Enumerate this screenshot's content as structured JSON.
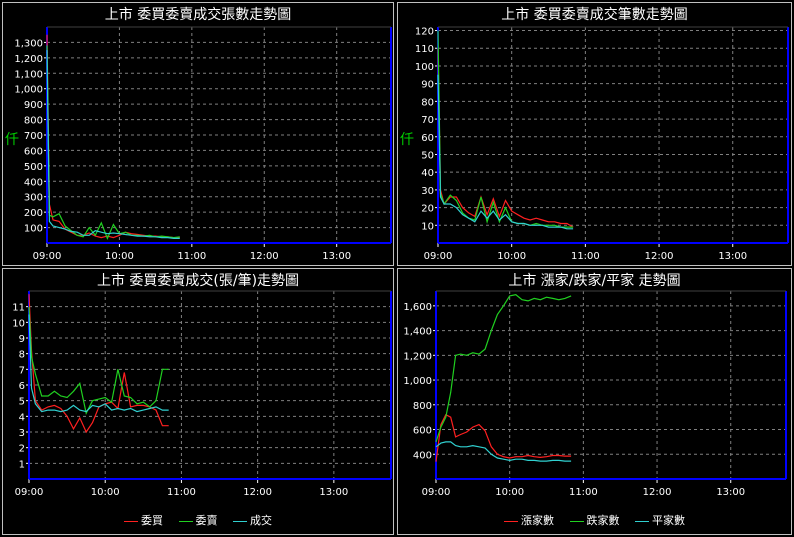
{
  "colors": {
    "red": "#ff2020",
    "green": "#20d020",
    "cyan": "#30d0d0",
    "axis": "#0000ff",
    "grid": "#808080",
    "text": "#ffffff"
  },
  "panels": [
    {
      "title": "上市  委買委賣成交張數走勢圖",
      "unit": "仟"
    },
    {
      "title": "上市  委買委賣成交筆數走勢圖",
      "unit": "仟"
    },
    {
      "title": "上市  委買委賣成交(張/筆)走勢圖",
      "legend": [
        "委買",
        "委賣",
        "成交"
      ]
    },
    {
      "title": "上市  漲家/跌家/平家  走勢圖",
      "legend": [
        "漲家數",
        "跌家數",
        "平家數"
      ]
    }
  ],
  "chart_data": [
    {
      "type": "line",
      "title": "上市  委買委賣成交張數走勢圖",
      "ylabel": "仟",
      "xlim": [
        540,
        825
      ],
      "ylim": [
        0,
        1400
      ],
      "x_ticks": [
        "09:00",
        "10:00",
        "11:00",
        "12:00",
        "13:00"
      ],
      "x_tick_values": [
        540,
        600,
        660,
        720,
        780
      ],
      "y_ticks": [
        "100",
        "200",
        "300",
        "400",
        "500",
        "600",
        "700",
        "800",
        "900",
        "1,000",
        "1,100",
        "1,200",
        "1,300"
      ],
      "y_tick_values": [
        100,
        200,
        300,
        400,
        500,
        600,
        700,
        800,
        900,
        1000,
        1100,
        1200,
        1300
      ],
      "series": [
        {
          "color": "red",
          "x": [
            540,
            542,
            545,
            550,
            555,
            560,
            565,
            570,
            575,
            580,
            585,
            590,
            595,
            600,
            605,
            610,
            615,
            620,
            625,
            630,
            635,
            640,
            645,
            650
          ],
          "y": [
            1350,
            250,
            150,
            140,
            90,
            70,
            50,
            50,
            65,
            45,
            35,
            45,
            35,
            50,
            70,
            60,
            55,
            50,
            45,
            45,
            40,
            40,
            35,
            35
          ]
        },
        {
          "color": "green",
          "x": [
            540,
            542,
            545,
            550,
            555,
            560,
            565,
            570,
            575,
            580,
            585,
            590,
            595,
            600,
            605,
            610,
            615,
            620,
            625,
            630,
            635,
            640,
            645,
            650
          ],
          "y": [
            1280,
            180,
            170,
            190,
            110,
            80,
            50,
            40,
            100,
            50,
            130,
            30,
            120,
            60,
            70,
            50,
            50,
            45,
            50,
            40,
            45,
            40,
            35,
            40
          ]
        },
        {
          "color": "cyan",
          "x": [
            540,
            542,
            545,
            550,
            555,
            560,
            565,
            570,
            575,
            580,
            585,
            590,
            595,
            600,
            605,
            610,
            615,
            620,
            625,
            630,
            635,
            640,
            645,
            650
          ],
          "y": [
            1250,
            140,
            110,
            100,
            90,
            75,
            70,
            50,
            50,
            80,
            70,
            60,
            65,
            60,
            55,
            50,
            45,
            45,
            40,
            40,
            35,
            35,
            30,
            30
          ]
        }
      ]
    },
    {
      "type": "line",
      "title": "上市  委買委賣成交筆數走勢圖",
      "ylabel": "仟",
      "xlim": [
        540,
        825
      ],
      "ylim": [
        0,
        122
      ],
      "x_ticks": [
        "09:00",
        "10:00",
        "11:00",
        "12:00",
        "13:00"
      ],
      "x_tick_values": [
        540,
        600,
        660,
        720,
        780
      ],
      "y_ticks": [
        "10",
        "20",
        "30",
        "40",
        "50",
        "60",
        "70",
        "80",
        "90",
        "100",
        "110",
        "120"
      ],
      "y_tick_values": [
        10,
        20,
        30,
        40,
        50,
        60,
        70,
        80,
        90,
        100,
        110,
        120
      ],
      "series": [
        {
          "color": "red",
          "x": [
            540,
            542,
            545,
            550,
            555,
            560,
            565,
            570,
            575,
            580,
            585,
            590,
            595,
            600,
            605,
            610,
            615,
            620,
            625,
            630,
            635,
            640,
            645,
            650
          ],
          "y": [
            110,
            30,
            22,
            26,
            26,
            20,
            17,
            15,
            26,
            16,
            25,
            15,
            24,
            18,
            16,
            14,
            13,
            14,
            13,
            12,
            12,
            11,
            11,
            9
          ]
        },
        {
          "color": "green",
          "x": [
            540,
            542,
            545,
            550,
            555,
            560,
            565,
            570,
            575,
            580,
            585,
            590,
            595,
            600,
            605,
            610,
            615,
            620,
            625,
            630,
            635,
            640,
            645,
            650
          ],
          "y": [
            120,
            28,
            22,
            27,
            24,
            17,
            14,
            13,
            26,
            12,
            23,
            12,
            20,
            12,
            11,
            11,
            10,
            11,
            10,
            10,
            10,
            9,
            9,
            9
          ]
        },
        {
          "color": "cyan",
          "x": [
            540,
            542,
            545,
            550,
            555,
            560,
            565,
            570,
            575,
            580,
            585,
            590,
            595,
            600,
            605,
            610,
            615,
            620,
            625,
            630,
            635,
            640,
            645,
            650
          ],
          "y": [
            95,
            26,
            22,
            22,
            20,
            16,
            14,
            12,
            18,
            14,
            18,
            13,
            16,
            12,
            11,
            11,
            10,
            10,
            10,
            9,
            9,
            9,
            8,
            8
          ]
        }
      ]
    },
    {
      "type": "line",
      "title": "上市  委買委賣成交(張/筆)走勢圖",
      "legend": [
        "委買",
        "委賣",
        "成交"
      ],
      "xlim": [
        540,
        825
      ],
      "ylim": [
        0,
        12
      ],
      "x_ticks": [
        "09:00",
        "10:00",
        "11:00",
        "12:00",
        "13:00"
      ],
      "x_tick_values": [
        540,
        600,
        660,
        720,
        780
      ],
      "y_ticks": [
        "1",
        "2",
        "3",
        "4",
        "5",
        "6",
        "7",
        "8",
        "9",
        "10",
        "11"
      ],
      "y_tick_values": [
        1,
        2,
        3,
        4,
        5,
        6,
        7,
        8,
        9,
        10,
        11
      ],
      "series": [
        {
          "color": "red",
          "name": "委買",
          "x": [
            540,
            542,
            545,
            550,
            555,
            560,
            565,
            570,
            575,
            580,
            585,
            590,
            595,
            600,
            605,
            610,
            615,
            620,
            625,
            630,
            635,
            640,
            645,
            650
          ],
          "y": [
            11.8,
            8.2,
            5.0,
            4.4,
            4.6,
            4.7,
            4.5,
            4.0,
            3.2,
            3.9,
            3.0,
            3.6,
            4.6,
            4.8,
            4.9,
            4.5,
            6.8,
            4.6,
            4.7,
            4.7,
            4.6,
            4.4,
            3.4,
            3.4
          ]
        },
        {
          "color": "green",
          "name": "委賣",
          "x": [
            540,
            542,
            545,
            550,
            555,
            560,
            565,
            570,
            575,
            580,
            585,
            590,
            595,
            600,
            605,
            610,
            615,
            620,
            625,
            630,
            635,
            640,
            645,
            650
          ],
          "y": [
            11.0,
            7.8,
            6.7,
            5.3,
            5.3,
            5.6,
            5.3,
            5.2,
            5.6,
            6.1,
            4.2,
            5.0,
            5.1,
            5.2,
            4.9,
            7.0,
            5.3,
            5.2,
            4.8,
            4.9,
            4.6,
            5.0,
            7.0,
            7.0
          ]
        },
        {
          "color": "cyan",
          "name": "成交",
          "x": [
            540,
            542,
            545,
            550,
            555,
            560,
            565,
            570,
            575,
            580,
            585,
            590,
            595,
            600,
            605,
            610,
            615,
            620,
            625,
            630,
            635,
            640,
            645,
            650
          ],
          "y": [
            10.5,
            5.8,
            4.8,
            4.3,
            4.4,
            4.4,
            4.3,
            4.4,
            4.7,
            4.4,
            4.3,
            4.7,
            4.6,
            4.8,
            4.4,
            4.5,
            4.4,
            4.5,
            4.3,
            4.4,
            4.5,
            4.6,
            4.4,
            4.4
          ]
        }
      ]
    },
    {
      "type": "line",
      "title": "上市  漲家/跌家/平家  走勢圖",
      "legend": [
        "漲家數",
        "跌家數",
        "平家數"
      ],
      "xlim": [
        540,
        825
      ],
      "ylim": [
        200,
        1720
      ],
      "x_ticks": [
        "09:00",
        "10:00",
        "11:00",
        "12:00",
        "13:00"
      ],
      "x_tick_values": [
        540,
        600,
        660,
        720,
        780
      ],
      "y_ticks": [
        "400",
        "600",
        "800",
        "1,000",
        "1,200",
        "1,400",
        "1,600"
      ],
      "y_tick_values": [
        400,
        600,
        800,
        1000,
        1200,
        1400,
        1600
      ],
      "series": [
        {
          "color": "red",
          "name": "漲家數",
          "x": [
            540,
            544,
            548,
            552,
            556,
            560,
            565,
            570,
            575,
            580,
            585,
            590,
            595,
            600,
            605,
            610,
            615,
            620,
            625,
            630,
            635,
            640,
            645,
            650
          ],
          "y": [
            340,
            640,
            720,
            700,
            540,
            560,
            580,
            620,
            640,
            590,
            460,
            400,
            380,
            370,
            380,
            380,
            390,
            380,
            375,
            380,
            390,
            390,
            385,
            385
          ]
        },
        {
          "color": "green",
          "name": "跌家數",
          "x": [
            540,
            544,
            548,
            552,
            556,
            560,
            565,
            570,
            575,
            580,
            585,
            590,
            595,
            600,
            605,
            610,
            615,
            620,
            625,
            630,
            635,
            640,
            645,
            650
          ],
          "y": [
            500,
            620,
            700,
            900,
            1200,
            1210,
            1200,
            1220,
            1210,
            1250,
            1400,
            1530,
            1600,
            1680,
            1690,
            1650,
            1640,
            1660,
            1650,
            1670,
            1660,
            1650,
            1660,
            1680
          ]
        },
        {
          "color": "cyan",
          "name": "平家數",
          "x": [
            540,
            544,
            548,
            552,
            556,
            560,
            565,
            570,
            575,
            580,
            585,
            590,
            595,
            600,
            605,
            610,
            615,
            620,
            625,
            630,
            635,
            640,
            645,
            650
          ],
          "y": [
            460,
            490,
            500,
            500,
            470,
            460,
            460,
            470,
            460,
            450,
            400,
            370,
            360,
            350,
            360,
            360,
            350,
            350,
            345,
            345,
            350,
            350,
            345,
            345
          ]
        }
      ]
    }
  ]
}
